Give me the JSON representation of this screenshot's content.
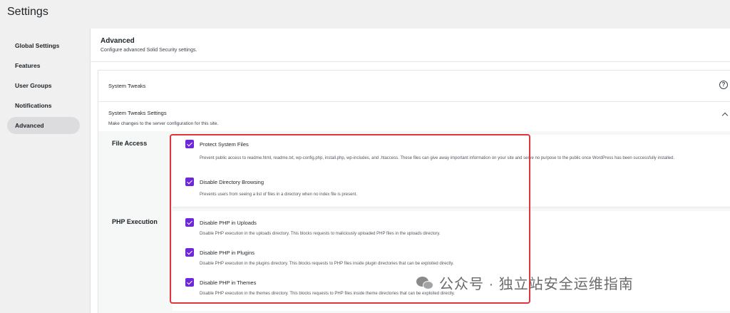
{
  "page": {
    "title": "Settings"
  },
  "sidebar": {
    "items": [
      {
        "label": "Global Settings"
      },
      {
        "label": "Features"
      },
      {
        "label": "User Groups"
      },
      {
        "label": "Notifications"
      },
      {
        "label": "Advanced"
      }
    ],
    "active": "Advanced"
  },
  "header": {
    "title": "Advanced",
    "subtitle": "Configure advanced Solid Security settings."
  },
  "system_tweaks": {
    "label": "System Tweaks",
    "help_icon": "question-circle-icon",
    "settings_title": "System Tweaks Settings",
    "settings_subtitle": "Make changes to the server configuration for this site."
  },
  "file_access": {
    "label": "File Access",
    "options": [
      {
        "label": "Protect System Files",
        "checked": true,
        "description": "Prevent public access to readme.html, readme.txt, wp-config.php, install.php, wp-includes, and .htaccess. These files can give away important information on your site and serve no purpose to the public once WordPress has been successfully installed."
      },
      {
        "label": "Disable Directory Browsing",
        "checked": true,
        "description": "Prevents users from seeing a list of files in a directory when no index file is present."
      }
    ]
  },
  "php_execution": {
    "label": "PHP Execution",
    "options": [
      {
        "label": "Disable PHP in Uploads",
        "checked": true,
        "description": "Disable PHP execution in the uploads directory. This blocks requests to maliciously uploaded PHP files in the uploads directory."
      },
      {
        "label": "Disable PHP in Plugins",
        "checked": true,
        "description": "Disable PHP execution in the plugins directory. This blocks requests to PHP files inside plugin directories that can be exploited directly."
      },
      {
        "label": "Disable PHP in Themes",
        "checked": true,
        "description": "Disable PHP execution in the themes directory. This blocks requests to PHP files inside theme directories that can be exploited directly."
      }
    ]
  },
  "colors": {
    "checkbox": "#6d28d9",
    "highlight": "#e0353d",
    "active_nav": "#dcdcde"
  },
  "watermark": {
    "text": "公众号 · 独立站安全运维指南"
  }
}
